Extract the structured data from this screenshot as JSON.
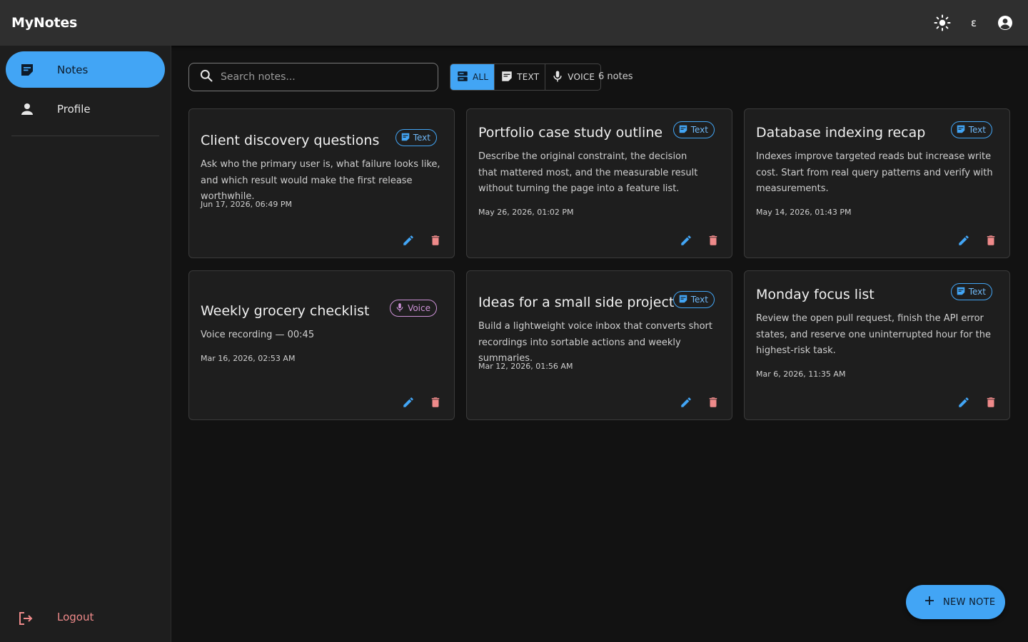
{
  "app": {
    "title": "MyNotes",
    "lang_glyph": "ε"
  },
  "colors": {
    "accent": "#42a5f5",
    "text_chip": "#42a5f5",
    "voice_chip": "#ce93d8",
    "delete": "#ef8a8a"
  },
  "sidebar": {
    "items": [
      {
        "label": "Notes",
        "icon": "note-icon",
        "active": true
      },
      {
        "label": "Profile",
        "icon": "person-icon",
        "active": false
      }
    ],
    "logout_label": "Logout"
  },
  "search": {
    "placeholder": "Search notes..."
  },
  "filters": [
    {
      "label": "ALL",
      "icon": "all-notes-icon",
      "active": true
    },
    {
      "label": "TEXT",
      "icon": "note-icon",
      "active": false
    },
    {
      "label": "VOICE",
      "icon": "mic-icon",
      "active": false
    }
  ],
  "note_count": "6 notes",
  "notes": [
    {
      "title": "Client discovery questions",
      "type": "Text",
      "body": "Ask who the primary user is, what failure looks like, and which result would make the first release worthwhile.",
      "date": "Jun 17, 2026, 06:49 PM"
    },
    {
      "title": "Portfolio case study outline",
      "type": "Text",
      "body": "Describe the original constraint, the decision that mattered most, and the measurable result without turning the page into a feature list.",
      "date": "May 26, 2026, 01:02 PM"
    },
    {
      "title": "Database indexing recap",
      "type": "Text",
      "body": "Indexes improve targeted reads but increase write cost. Start from real query patterns and verify with measurements.",
      "date": "May 14, 2026, 01:43 PM"
    },
    {
      "title": "Weekly grocery checklist",
      "type": "Voice",
      "body": "Voice recording — 00:45",
      "date": "Mar 16, 2026, 02:53 AM"
    },
    {
      "title": "Ideas for a small side project",
      "type": "Text",
      "body": "Build a lightweight voice inbox that converts short recordings into sortable actions and weekly summaries.",
      "date": "Mar 12, 2026, 01:56 AM"
    },
    {
      "title": "Monday focus list",
      "type": "Text",
      "body": "Review the open pull request, finish the API error states, and reserve one uninterrupted hour for the highest-risk task.",
      "date": "Mar 6, 2026, 11:35 AM"
    }
  ],
  "fab": {
    "label": "NEW NOTE",
    "icon": "plus-icon"
  }
}
